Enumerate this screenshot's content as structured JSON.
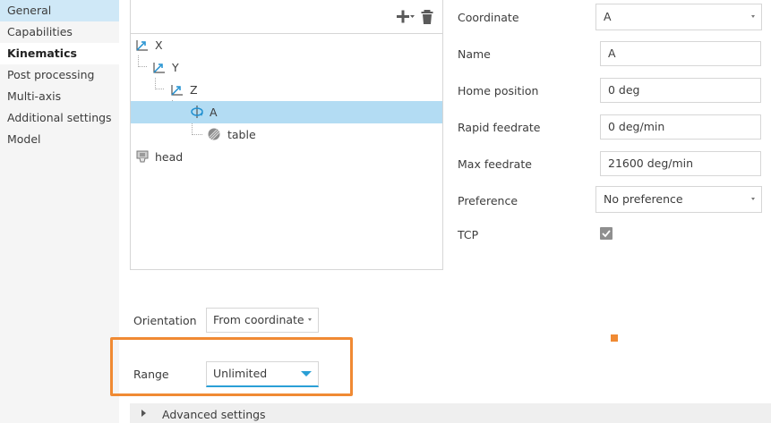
{
  "sidebar": {
    "items": [
      {
        "label": "General"
      },
      {
        "label": "Capabilities"
      },
      {
        "label": "Kinematics"
      },
      {
        "label": "Post processing"
      },
      {
        "label": "Multi-axis"
      },
      {
        "label": "Additional settings"
      },
      {
        "label": "Model"
      }
    ]
  },
  "tree": {
    "toolbar": {
      "add_icon": "plus-dropdown-icon",
      "delete_icon": "trash-icon"
    },
    "nodes": [
      {
        "label": "X",
        "icon": "linear-axis-icon",
        "depth": 0
      },
      {
        "label": "Y",
        "icon": "linear-axis-icon",
        "depth": 1
      },
      {
        "label": "Z",
        "icon": "linear-axis-icon",
        "depth": 2
      },
      {
        "label": "A",
        "icon": "rotary-axis-icon",
        "depth": 3,
        "selected": true
      },
      {
        "label": "table",
        "icon": "table-icon",
        "depth": 4
      },
      {
        "label": "head",
        "icon": "head-icon",
        "depth": 0
      }
    ]
  },
  "properties": {
    "coordinate": {
      "label": "Coordinate",
      "value": "A"
    },
    "name": {
      "label": "Name",
      "value": "A"
    },
    "home_position": {
      "label": "Home position",
      "value": "0 deg"
    },
    "rapid_feedrate": {
      "label": "Rapid feedrate",
      "value": "0 deg/min"
    },
    "max_feedrate": {
      "label": "Max feedrate",
      "value": "21600 deg/min"
    },
    "preference": {
      "label": "Preference",
      "value": "No preference"
    },
    "tcp": {
      "label": "TCP",
      "checked": true
    }
  },
  "orientation": {
    "label": "Orientation",
    "value": "From coordinate"
  },
  "range": {
    "label": "Range",
    "value": "Unlimited"
  },
  "advanced": {
    "label": "Advanced settings"
  },
  "colors": {
    "selection": "#b3dcf3",
    "sidebar_hover": "#cfe8f7",
    "accent": "#2a9fd6",
    "highlight": "#f08a33",
    "axis_icon": "#1f8fd0"
  }
}
